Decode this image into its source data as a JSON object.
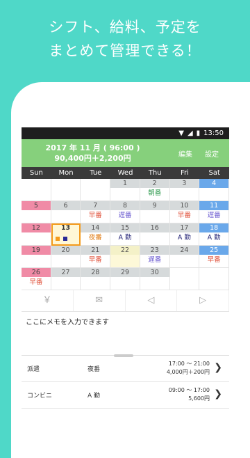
{
  "promo": {
    "line1": "シフト、給料、予定を",
    "line2": "まとめて管理できる！"
  },
  "status": {
    "time": "13:50"
  },
  "header": {
    "title": "2017 年 11 月 ( 96:00 )",
    "sub": "90,400円＋2,200円",
    "edit": "編集",
    "settings": "設定"
  },
  "weekdays": [
    "Sun",
    "Mon",
    "Tue",
    "Wed",
    "Thu",
    "Fri",
    "Sat"
  ],
  "days": [
    {
      "d": "",
      "s": ""
    },
    {
      "d": "",
      "s": ""
    },
    {
      "d": "",
      "s": ""
    },
    {
      "d": "1",
      "s": ""
    },
    {
      "d": "2",
      "s": "朝番",
      "c": "#2e9a4e"
    },
    {
      "d": "3",
      "s": ""
    },
    {
      "d": "4",
      "s": ""
    },
    {
      "d": "5",
      "s": ""
    },
    {
      "d": "6",
      "s": ""
    },
    {
      "d": "7",
      "s": "早番",
      "c": "#e0503a"
    },
    {
      "d": "8",
      "s": "遅番",
      "c": "#6a5ad0"
    },
    {
      "d": "9",
      "s": ""
    },
    {
      "d": "10",
      "s": "早番",
      "c": "#e0503a"
    },
    {
      "d": "11",
      "s": "遅番",
      "c": "#6a5ad0"
    },
    {
      "d": "12",
      "s": ""
    },
    {
      "d": "13",
      "s": "",
      "today": true
    },
    {
      "d": "14",
      "s": "夜番",
      "c": "#e07a10"
    },
    {
      "d": "15",
      "s": "A 勤",
      "c": "#2a2a7a"
    },
    {
      "d": "16",
      "s": ""
    },
    {
      "d": "17",
      "s": "A 勤",
      "c": "#2a2a7a"
    },
    {
      "d": "18",
      "s": "A 勤",
      "c": "#2a2a7a"
    },
    {
      "d": "19",
      "s": ""
    },
    {
      "d": "20",
      "s": ""
    },
    {
      "d": "21",
      "s": "早番",
      "c": "#e0503a"
    },
    {
      "d": "22",
      "s": "",
      "hl": true
    },
    {
      "d": "23",
      "s": "遅番",
      "c": "#6a5ad0"
    },
    {
      "d": "24",
      "s": ""
    },
    {
      "d": "25",
      "s": "早番",
      "c": "#e0503a"
    },
    {
      "d": "26",
      "s": "早番",
      "c": "#e0503a"
    },
    {
      "d": "27",
      "s": ""
    },
    {
      "d": "28",
      "s": ""
    },
    {
      "d": "29",
      "s": ""
    },
    {
      "d": "30",
      "s": ""
    },
    {
      "d": "",
      "s": ""
    },
    {
      "d": "",
      "s": ""
    }
  ],
  "toolbar": {
    "yen": "￥",
    "mail": "✉",
    "prev": "◁",
    "next": "▷"
  },
  "memo": "ここにメモを入力できます",
  "entries": [
    {
      "name": "派遣",
      "shift": "夜番",
      "time": "17:00 〜 21:00",
      "pay": "4,000円＋200円"
    },
    {
      "name": "コンビニ",
      "shift": "A 勤",
      "time": "09:00 〜 17:00",
      "pay": "5,600円"
    }
  ]
}
